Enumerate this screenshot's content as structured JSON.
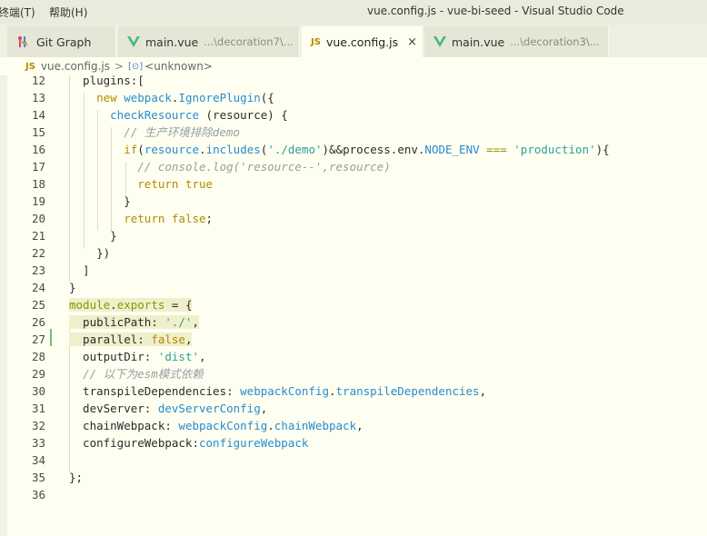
{
  "titlebar": {
    "menu": [
      "终端(T)",
      "帮助(H)"
    ],
    "window_title": "vue.config.js - vue-bi-seed - Visual Studio Code"
  },
  "tabs": [
    {
      "label": "Git Graph",
      "hint": "",
      "icon": "git-graph-icon",
      "active": false
    },
    {
      "label": "main.vue",
      "hint": "...\\decoration7\\...",
      "icon": "vue-icon",
      "active": false
    },
    {
      "label": "vue.config.js",
      "hint": "",
      "icon": "js-icon",
      "icon_text": "JS",
      "active": true,
      "close": "×"
    },
    {
      "label": "main.vue",
      "hint": "...\\decoration3\\...",
      "icon": "vue-icon",
      "active": false
    }
  ],
  "breadcrumb": {
    "file_badge": "JS",
    "file": "vue.config.js",
    "separator": ">",
    "symbol_badge": "[⊙]",
    "symbol": "<unknown>"
  },
  "colors": {
    "background": "#fffff1",
    "keyword": "#b58900",
    "function": "#268bd2",
    "string": "#2aa198",
    "comment": "#93a1a1",
    "vue_green": "#41b883",
    "modified_gutter": "#7aba7a"
  },
  "code": [
    {
      "n": "12",
      "tokens": [
        [
          "t-text",
          "  plugins:["
        ]
      ]
    },
    {
      "n": "13",
      "tokens": [
        [
          "t-text",
          "    "
        ],
        [
          "t-keyword",
          "new"
        ],
        [
          "t-text",
          " "
        ],
        [
          "t-func",
          "webpack"
        ],
        [
          "t-text",
          "."
        ],
        [
          "t-func",
          "IgnorePlugin"
        ],
        [
          "t-text",
          "({"
        ]
      ]
    },
    {
      "n": "14",
      "tokens": [
        [
          "t-text",
          "      "
        ],
        [
          "t-func",
          "checkResource"
        ],
        [
          "t-text",
          " (resource) {"
        ]
      ]
    },
    {
      "n": "15",
      "tokens": [
        [
          "t-text",
          "        "
        ],
        [
          "t-comment",
          "// 生产环境排除demo"
        ]
      ]
    },
    {
      "n": "16",
      "tokens": [
        [
          "t-text",
          "        "
        ],
        [
          "t-keyword",
          "if"
        ],
        [
          "t-text",
          "("
        ],
        [
          "t-prop",
          "resource"
        ],
        [
          "t-text",
          "."
        ],
        [
          "t-func",
          "includes"
        ],
        [
          "t-text",
          "("
        ],
        [
          "t-string",
          "'./demo'"
        ],
        [
          "t-text",
          ")&&process.env."
        ],
        [
          "t-prop",
          "NODE_ENV"
        ],
        [
          "t-text",
          " "
        ],
        [
          "t-kw2",
          "==="
        ],
        [
          "t-text",
          " "
        ],
        [
          "t-string",
          "'production'"
        ],
        [
          "t-text",
          "){"
        ]
      ]
    },
    {
      "n": "17",
      "tokens": [
        [
          "t-text",
          "          "
        ],
        [
          "t-comment",
          "// console.log('resource--',resource)"
        ]
      ]
    },
    {
      "n": "18",
      "tokens": [
        [
          "t-text",
          "          "
        ],
        [
          "t-keyword",
          "return"
        ],
        [
          "t-text",
          " "
        ],
        [
          "t-keyword",
          "true"
        ]
      ]
    },
    {
      "n": "19",
      "tokens": [
        [
          "t-text",
          "        }"
        ]
      ]
    },
    {
      "n": "20",
      "tokens": [
        [
          "t-text",
          "        "
        ],
        [
          "t-keyword",
          "return"
        ],
        [
          "t-text",
          " "
        ],
        [
          "t-keyword",
          "false"
        ],
        [
          "t-text",
          ";"
        ]
      ]
    },
    {
      "n": "21",
      "tokens": [
        [
          "t-text",
          "      }"
        ]
      ]
    },
    {
      "n": "22",
      "tokens": [
        [
          "t-text",
          "    })"
        ]
      ]
    },
    {
      "n": "23",
      "tokens": [
        [
          "t-text",
          "  ]"
        ]
      ]
    },
    {
      "n": "24",
      "tokens": [
        [
          "t-text",
          "}"
        ]
      ]
    },
    {
      "n": "25",
      "tokens": [
        [
          "t-kw2",
          "module"
        ],
        [
          "t-text",
          "."
        ],
        [
          "t-kw2",
          "exports"
        ],
        [
          "t-text",
          " = {"
        ]
      ],
      "highlight": true
    },
    {
      "n": "26",
      "tokens": [
        [
          "t-text",
          "  publicPath: "
        ],
        [
          "t-string",
          "'./'"
        ],
        [
          "t-text",
          ","
        ]
      ],
      "highlight": true
    },
    {
      "n": "27",
      "tokens": [
        [
          "t-text",
          "  parallel: "
        ],
        [
          "t-keyword",
          "false"
        ],
        [
          "t-text",
          ","
        ]
      ],
      "highlight": true
    },
    {
      "n": "28",
      "tokens": [
        [
          "t-text",
          "  outputDir: "
        ],
        [
          "t-string",
          "'dist'"
        ],
        [
          "t-text",
          ","
        ]
      ]
    },
    {
      "n": "29",
      "tokens": [
        [
          "t-text",
          "  "
        ],
        [
          "t-comment",
          "// 以下为esm模式依赖"
        ]
      ]
    },
    {
      "n": "30",
      "tokens": [
        [
          "t-text",
          "  transpileDependencies: "
        ],
        [
          "t-prop",
          "webpackConfig"
        ],
        [
          "t-text",
          "."
        ],
        [
          "t-prop",
          "transpileDependencies"
        ],
        [
          "t-text",
          ","
        ]
      ]
    },
    {
      "n": "31",
      "tokens": [
        [
          "t-text",
          "  devServer: "
        ],
        [
          "t-prop",
          "devServerConfig"
        ],
        [
          "t-text",
          ","
        ]
      ]
    },
    {
      "n": "32",
      "tokens": [
        [
          "t-text",
          "  chainWebpack: "
        ],
        [
          "t-prop",
          "webpackConfig"
        ],
        [
          "t-text",
          "."
        ],
        [
          "t-prop",
          "chainWebpack"
        ],
        [
          "t-text",
          ","
        ]
      ]
    },
    {
      "n": "33",
      "tokens": [
        [
          "t-text",
          "  configureWebpack:"
        ],
        [
          "t-prop",
          "configureWebpack"
        ]
      ]
    },
    {
      "n": "34",
      "tokens": []
    },
    {
      "n": "35",
      "tokens": [
        [
          "t-text",
          "};"
        ]
      ]
    },
    {
      "n": "36",
      "tokens": []
    }
  ]
}
